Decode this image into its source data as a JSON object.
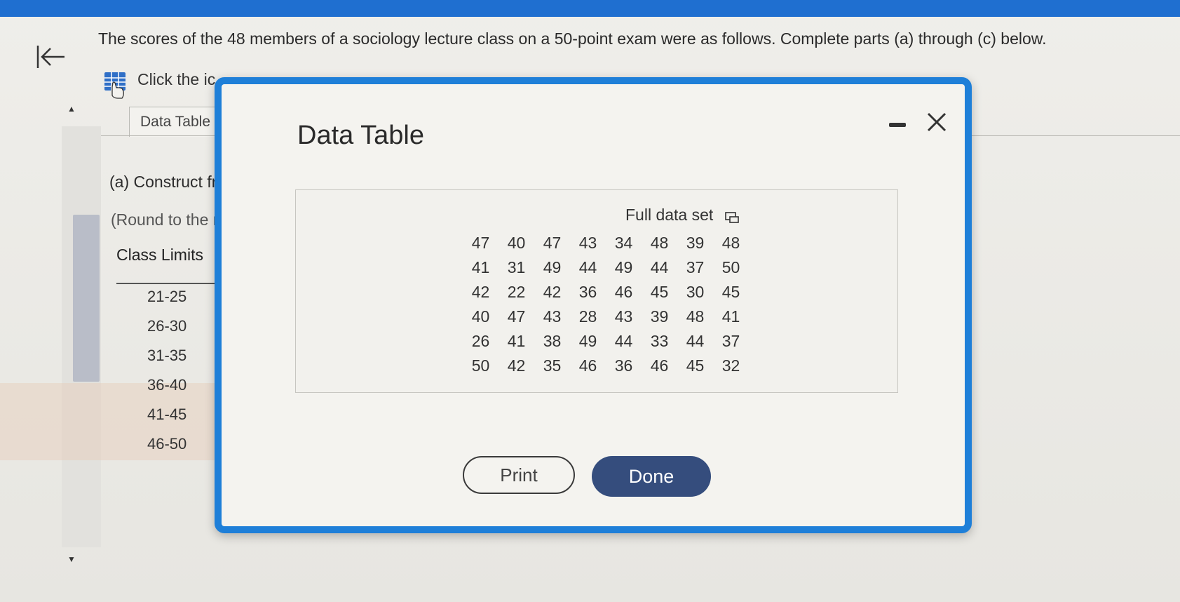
{
  "question": {
    "text": "The scores of the 48 members of a sociology lecture class on a 50-point exam were as follows. Complete parts (a) through (c) below."
  },
  "instructions": {
    "click_text": "Click the ic"
  },
  "tabs": {
    "data_table": "Data Table"
  },
  "part_a": {
    "text": "(a) Construct fr",
    "round_text": "(Round to the n"
  },
  "class_table": {
    "header": "Class Limits",
    "rows": [
      "21-25",
      "26-30",
      "31-35",
      "36-40",
      "41-45",
      "46-50"
    ]
  },
  "modal": {
    "title": "Data Table",
    "full_data_label": "Full data set",
    "data_rows": [
      [
        "47",
        "40",
        "47",
        "43",
        "34",
        "48",
        "39",
        "48"
      ],
      [
        "41",
        "31",
        "49",
        "44",
        "49",
        "44",
        "37",
        "50"
      ],
      [
        "42",
        "22",
        "42",
        "36",
        "46",
        "45",
        "30",
        "45"
      ],
      [
        "40",
        "47",
        "43",
        "28",
        "43",
        "39",
        "48",
        "41"
      ],
      [
        "26",
        "41",
        "38",
        "49",
        "44",
        "33",
        "44",
        "37"
      ],
      [
        "50",
        "42",
        "35",
        "46",
        "36",
        "46",
        "45",
        "32"
      ]
    ],
    "print_label": "Print",
    "done_label": "Done"
  },
  "icons": {
    "back": "back-to-start-icon",
    "table": "table-icon",
    "minimize": "minimize-icon",
    "close": "close-icon",
    "copy": "copy-icon"
  },
  "colors": {
    "modal_border": "#1e7fd8",
    "done_button": "#354d7d",
    "top_bar": "#1f6fd0"
  }
}
